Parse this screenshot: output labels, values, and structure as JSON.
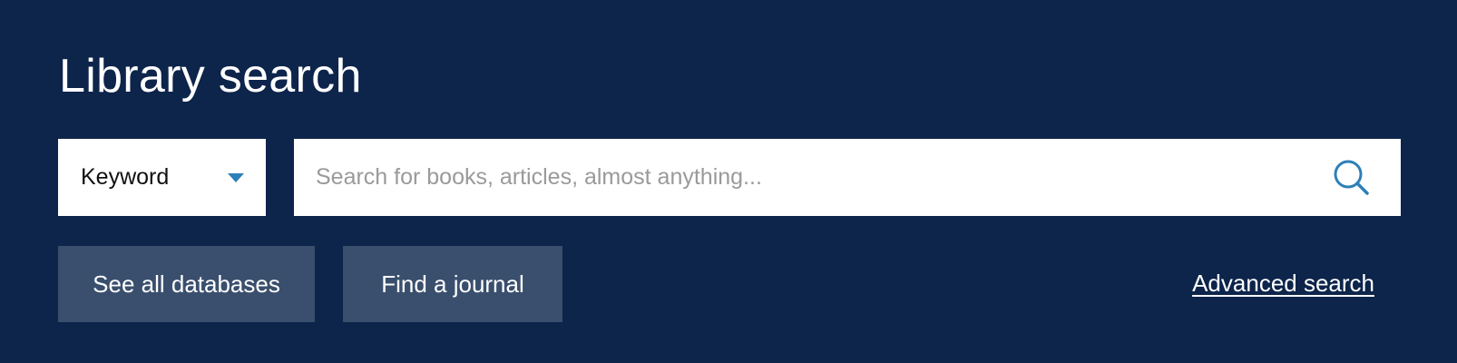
{
  "header": {
    "title": "Library search"
  },
  "search": {
    "type_selector": {
      "selected": "Keyword",
      "icon": "chevron-down-icon"
    },
    "input": {
      "value": "",
      "placeholder": "Search for books, articles, almost anything..."
    },
    "submit_icon": "search-icon"
  },
  "actions": {
    "databases_label": "See all databases",
    "journal_label": "Find a journal",
    "advanced_label": "Advanced search"
  },
  "colors": {
    "background": "#0d244b",
    "button_background": "#3a4f6d",
    "accent": "#2d7fb8",
    "text_light": "#ffffff",
    "placeholder": "#9a9a9a"
  }
}
